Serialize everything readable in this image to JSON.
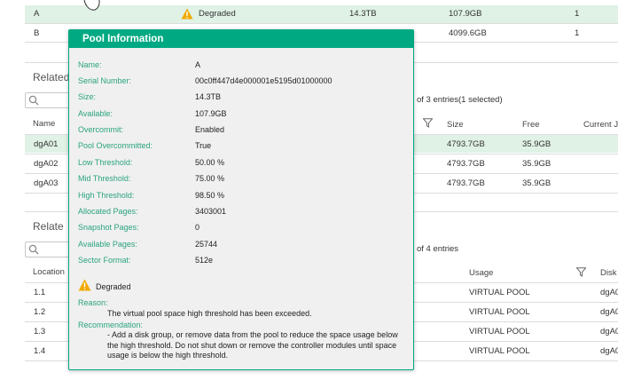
{
  "pool_table": {
    "rows": [
      {
        "name": "A",
        "health": "Degraded",
        "size": "14.3TB",
        "available": "107.9GB",
        "count": "1",
        "selected": true
      },
      {
        "name": "B",
        "health": "",
        "size": "",
        "available": "4099.6GB",
        "count": "1",
        "selected": false
      }
    ]
  },
  "related_disk_groups": {
    "title": "Related",
    "entries_text": "of 3 entries(1 selected)",
    "headers": {
      "name": "Name",
      "size": "Size",
      "free": "Free",
      "current": "Current J"
    },
    "rows": [
      {
        "name": "dgA01",
        "size": "4793.7GB",
        "free": "35.9GB",
        "selected": true
      },
      {
        "name": "dgA02",
        "size": "4793.7GB",
        "free": "35.9GB",
        "selected": false
      },
      {
        "name": "dgA03",
        "size": "4793.7GB",
        "free": "35.9GB",
        "selected": false
      }
    ]
  },
  "related_disks": {
    "title": "Relate",
    "entries_text": "of 4 entries",
    "headers": {
      "location": "Location",
      "usage": "Usage",
      "disk": "Disk"
    },
    "rows": [
      {
        "location": "1.1",
        "usage": "VIRTUAL POOL",
        "disk": "dgA0"
      },
      {
        "location": "1.2",
        "usage": "VIRTUAL POOL",
        "disk": "dgA0"
      },
      {
        "location": "1.3",
        "usage": "VIRTUAL POOL",
        "disk": "dgA0"
      },
      {
        "location": "1.4",
        "usage": "VIRTUAL POOL",
        "disk": "dgA0"
      }
    ]
  },
  "popup": {
    "title": "Pool Information",
    "fields": [
      {
        "label": "Name:",
        "value": "A"
      },
      {
        "label": "Serial Number:",
        "value": "00c0ff447d4e000001e5195d01000000"
      },
      {
        "label": "Size:",
        "value": "14.3TB"
      },
      {
        "label": "Available:",
        "value": "107.9GB"
      },
      {
        "label": "Overcommit:",
        "value": "Enabled"
      },
      {
        "label": "Pool Overcommitted:",
        "value": "True"
      },
      {
        "label": "Low Threshold:",
        "value": "50.00 %"
      },
      {
        "label": "Mid Threshold:",
        "value": "75.00 %"
      },
      {
        "label": "High Threshold:",
        "value": "98.50 %"
      },
      {
        "label": "Allocated Pages:",
        "value": "3403001"
      },
      {
        "label": "Snapshot Pages:",
        "value": "0"
      },
      {
        "label": "Available Pages:",
        "value": "25744"
      },
      {
        "label": "Sector Format:",
        "value": "512e"
      }
    ],
    "status": "Degraded",
    "reason_label": "Reason:",
    "reason_text": "The virtual pool space high threshold has been exceeded.",
    "recommendation_label": "Recommendation:",
    "recommendation_text": "- Add a disk group, or remove data from the pool to reduce the space usage below the high threshold. Do not shut down or remove the controller modules until space usage is below the high threshold."
  },
  "colors": {
    "accent": "#01a982",
    "warning": "#f2a900",
    "selected_row": "#dff2e5"
  },
  "icons": {
    "warning": "warning-icon",
    "search": "search-icon",
    "filter": "filter-icon",
    "cursor": "hand-cursor-icon"
  }
}
